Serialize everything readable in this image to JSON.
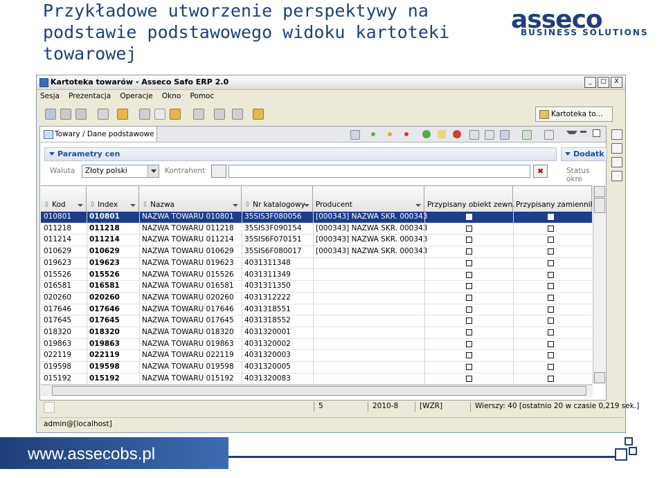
{
  "slide": {
    "title": "Przykładowe utworzenie perspektywy na podstawie podstawowego widoku kartoteki towarowej",
    "logo_word": "asseco",
    "logo_sub": "BUSINESS SOLUTIONS",
    "footer_url": "www.assecobs.pl"
  },
  "window": {
    "title": "Kartoteka towarów - Asseco Safo ERP 2.0",
    "controls": [
      "_",
      "□",
      "X"
    ]
  },
  "menu": [
    "Sesja",
    "Prezentacja",
    "Operacje",
    "Okno",
    "Pomoc"
  ],
  "perspective_button": "Kartoteka to...",
  "tab": {
    "label": "Towary / Dane podstawowe"
  },
  "params": {
    "section_label": "Parametry cen",
    "dodatk_label": "Dodatk",
    "waluta_label": "Waluta",
    "waluta_value": "Złoty polski",
    "kontrahent_label": "Kontrahent",
    "status_label": "Status okre",
    "clear_btn": "✖"
  },
  "grid": {
    "columns": [
      "Kod",
      "Index",
      "Nazwa",
      "Nr katalogowy",
      "Producent",
      "Przypisany obiekt zewn.",
      "Przypisany zamiennik"
    ],
    "rows": [
      {
        "kod": "010801",
        "index": "010801",
        "nazwa": "NAZWA TOWARU 010801",
        "nr": "35SIS3F080056",
        "producent": "[000343] NAZWA SKR. 000343",
        "obj": true,
        "zam": true
      },
      {
        "kod": "011218",
        "index": "011218",
        "nazwa": "NAZWA TOWARU 011218",
        "nr": "35SIS3F090154",
        "producent": "[000343] NAZWA SKR. 000343",
        "obj": false,
        "zam": false
      },
      {
        "kod": "011214",
        "index": "011214",
        "nazwa": "NAZWA TOWARU 011214",
        "nr": "35SIS6F070151",
        "producent": "[000343] NAZWA SKR. 000343",
        "obj": false,
        "zam": false
      },
      {
        "kod": "010629",
        "index": "010629",
        "nazwa": "NAZWA TOWARU 010629",
        "nr": "35SIS6F080017",
        "producent": "[000343] NAZWA SKR. 000343",
        "obj": false,
        "zam": false
      },
      {
        "kod": "019623",
        "index": "019623",
        "nazwa": "NAZWA TOWARU 019623",
        "nr": "4031311348",
        "producent": "",
        "obj": false,
        "zam": false
      },
      {
        "kod": "015526",
        "index": "015526",
        "nazwa": "NAZWA TOWARU 015526",
        "nr": "4031311349",
        "producent": "",
        "obj": false,
        "zam": false
      },
      {
        "kod": "016581",
        "index": "016581",
        "nazwa": "NAZWA TOWARU 016581",
        "nr": "4031311350",
        "producent": "",
        "obj": false,
        "zam": false
      },
      {
        "kod": "020260",
        "index": "020260",
        "nazwa": "NAZWA TOWARU 020260",
        "nr": "4031312222",
        "producent": "",
        "obj": false,
        "zam": false
      },
      {
        "kod": "017646",
        "index": "017646",
        "nazwa": "NAZWA TOWARU 017646",
        "nr": "4031318551",
        "producent": "",
        "obj": false,
        "zam": false
      },
      {
        "kod": "017645",
        "index": "017645",
        "nazwa": "NAZWA TOWARU 017645",
        "nr": "4031318552",
        "producent": "",
        "obj": false,
        "zam": false
      },
      {
        "kod": "018320",
        "index": "018320",
        "nazwa": "NAZWA TOWARU 018320",
        "nr": "4031320001",
        "producent": "",
        "obj": false,
        "zam": false
      },
      {
        "kod": "019863",
        "index": "019863",
        "nazwa": "NAZWA TOWARU 019863",
        "nr": "4031320002",
        "producent": "",
        "obj": false,
        "zam": false
      },
      {
        "kod": "022119",
        "index": "022119",
        "nazwa": "NAZWA TOWARU 022119",
        "nr": "4031320003",
        "producent": "",
        "obj": false,
        "zam": false
      },
      {
        "kod": "019598",
        "index": "019598",
        "nazwa": "NAZWA TOWARU 019598",
        "nr": "4031320005",
        "producent": "",
        "obj": false,
        "zam": false
      },
      {
        "kod": "015192",
        "index": "015192",
        "nazwa": "NAZWA TOWARU 015192",
        "nr": "4031320083",
        "producent": "",
        "obj": false,
        "zam": false
      }
    ]
  },
  "status": {
    "seg1": "5",
    "seg2": "2010-8",
    "seg3": "[WZR]",
    "seg4": "Wierszy: 40 [ostatnio 20 w czasie 0,219 sek.]",
    "user": "admin@[localhost]"
  },
  "colors": {
    "accent": "#1f3f7a",
    "selection": "#1c3c8c"
  }
}
